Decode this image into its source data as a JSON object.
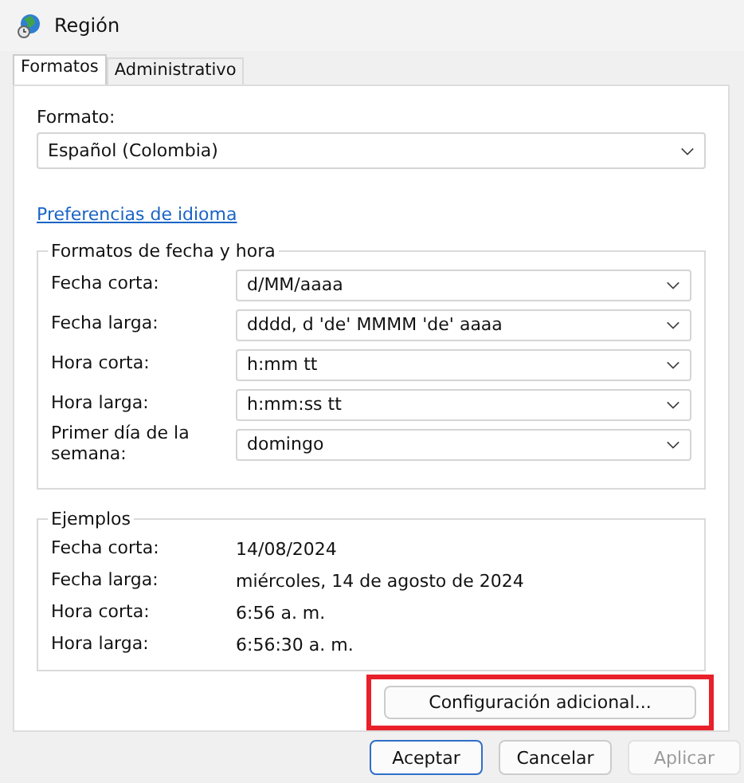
{
  "window": {
    "title": "Región"
  },
  "tabs": [
    {
      "label": "Formatos",
      "selected": true
    },
    {
      "label": "Administrativo",
      "selected": false
    }
  ],
  "format": {
    "label": "Formato:",
    "value": "Español (Colombia)"
  },
  "language_link": "Preferencias de idioma",
  "date_time_formats": {
    "title": "Formatos de fecha y hora",
    "rows": [
      {
        "label": "Fecha corta:",
        "value": "d/MM/aaaa"
      },
      {
        "label": "Fecha larga:",
        "value": "dddd, d 'de' MMMM 'de' aaaa"
      },
      {
        "label": "Hora corta:",
        "value": "h:mm tt"
      },
      {
        "label": "Hora larga:",
        "value": "h:mm:ss tt"
      },
      {
        "label": "Primer día de la semana:",
        "value": "domingo"
      }
    ]
  },
  "examples": {
    "title": "Ejemplos",
    "rows": [
      {
        "label": "Fecha corta:",
        "value": "14/08/2024"
      },
      {
        "label": "Fecha larga:",
        "value": "miércoles, 14 de agosto de 2024"
      },
      {
        "label": "Hora corta:",
        "value": "6:56 a. m."
      },
      {
        "label": "Hora larga:",
        "value": "6:56:30 a. m."
      }
    ]
  },
  "additional_button": {
    "label": "Configuración adicional...",
    "highlighted": true
  },
  "buttons": [
    {
      "label": "Aceptar",
      "disabled": false,
      "default": true
    },
    {
      "label": "Cancelar",
      "disabled": false,
      "default": false
    },
    {
      "label": "Aplicar",
      "disabled": true,
      "default": false
    }
  ]
}
